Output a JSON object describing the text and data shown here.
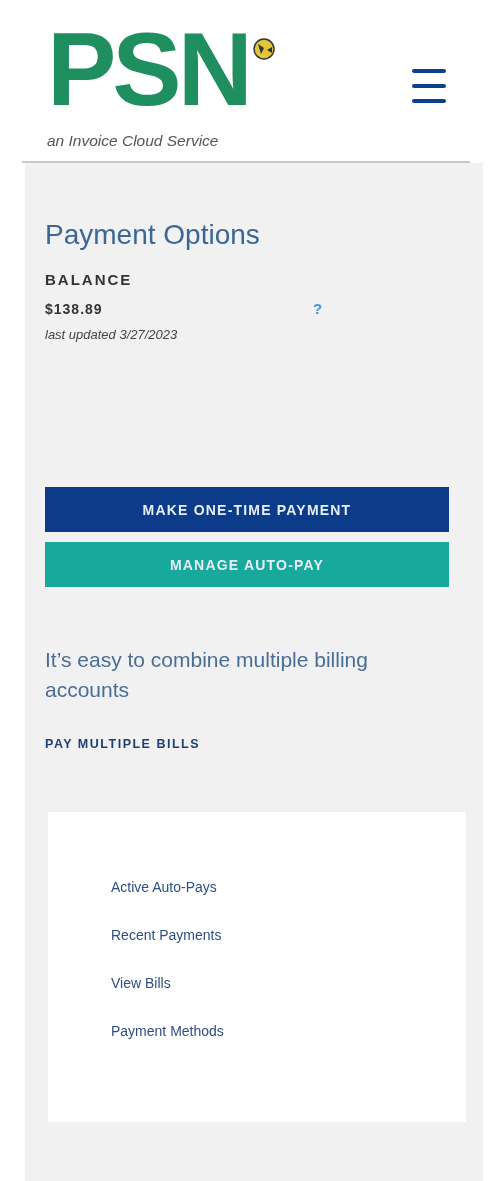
{
  "header": {
    "logo_text": "PSN",
    "tagline": "an Invoice Cloud Service"
  },
  "title": "Payment Options",
  "balance": {
    "label": "BALANCE",
    "amount": "$138.89",
    "help": "?",
    "updated": "last updated 3/27/2023"
  },
  "buttons": [
    {
      "label": "MAKE ONE-TIME PAYMENT",
      "kind": "primary"
    },
    {
      "label": "MANAGE AUTO-PAY",
      "kind": "secondary"
    }
  ],
  "combine": {
    "text": "It’s easy to combine multiple billing accounts",
    "link": "PAY MULTIPLE BILLS"
  },
  "links": [
    "Active Auto-Pays",
    "Recent Payments",
    "View Bills",
    "Payment Methods"
  ]
}
